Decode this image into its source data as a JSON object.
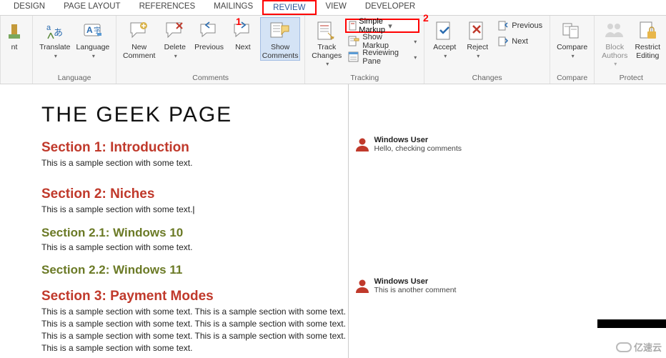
{
  "tabs": {
    "design": "DESIGN",
    "page_layout": "PAGE LAYOUT",
    "references": "REFERENCES",
    "mailings": "MAILINGS",
    "review": "REVIEW",
    "view": "VIEW",
    "developer": "DEVELOPER"
  },
  "callouts": {
    "one": "1",
    "two": "2"
  },
  "ribbon": {
    "language": {
      "translate": "Translate",
      "language": "Language",
      "group": "Language"
    },
    "comments": {
      "new": "New\nComment",
      "delete": "Delete",
      "previous": "Previous",
      "next": "Next",
      "show": "Show\nComments",
      "group": "Comments"
    },
    "tracking": {
      "track": "Track\nChanges",
      "markup_selected": "Simple Markup",
      "show_markup": "Show Markup",
      "reviewing_pane": "Reviewing Pane",
      "group": "Tracking"
    },
    "changes": {
      "accept": "Accept",
      "reject": "Reject",
      "previous": "Previous",
      "next": "Next",
      "group": "Changes"
    },
    "compare": {
      "compare": "Compare",
      "group": "Compare"
    },
    "protect": {
      "block": "Block\nAuthors",
      "restrict": "Restrict\nEditing",
      "group": "Protect"
    }
  },
  "document": {
    "title": "THE GEEK PAGE",
    "s1_h": "Section 1: Introduction",
    "s1_t": "This is a sample section with some text.",
    "s2_h": "Section 2: Niches",
    "s2_t": "This is a sample section with some text.",
    "s21_h": "Section 2.1: Windows 10",
    "s21_t": "This is a sample section with some text.",
    "s22_h": "Section 2.2: Windows 11",
    "s3_h": "Section 3: Payment Modes",
    "s3_t": "This is a sample section with some text. This is a sample section with some text. This is a sample section with some text. This is a sample section with some text. This is a sample section with some text. This is a sample section with some text. This is a sample section with some text."
  },
  "comments": {
    "c1_user": "Windows User",
    "c1_text": "Hello, checking comments",
    "c2_user": "Windows User",
    "c2_text": "This is another comment"
  },
  "watermark": "亿速云"
}
